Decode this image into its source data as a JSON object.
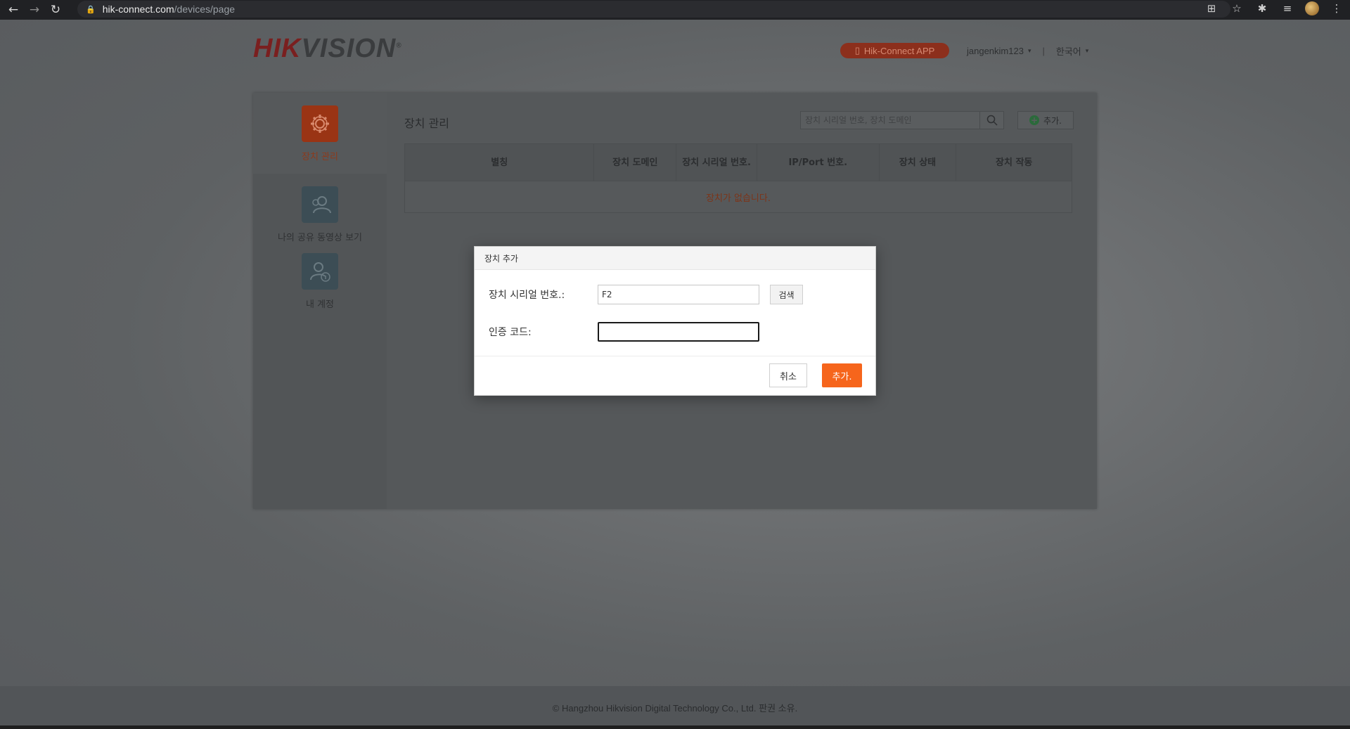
{
  "browser": {
    "url_domain": "hik-connect.com",
    "url_path": "/devices/page"
  },
  "header": {
    "logo_hik": "HIK",
    "logo_vision": "VISION",
    "app_button": "Hik-Connect APP",
    "username": "jangenkim123",
    "language": "한국어"
  },
  "sidebar": {
    "items": [
      {
        "label": "장치 관리",
        "icon": "gear-icon",
        "active": true
      },
      {
        "label": "나의 공유 동영상 보기",
        "icon": "shared-users-icon",
        "active": false
      },
      {
        "label": "내 계정",
        "icon": "account-info-icon",
        "active": false
      }
    ]
  },
  "main": {
    "title": "장치 관리",
    "search_placeholder": "장치 시리얼 번호, 장치 도메인",
    "add_button": "추가.",
    "table": {
      "columns": [
        "별칭",
        "장치 도메인",
        "장치 시리얼 번호.",
        "IP/Port 번호.",
        "장치 상태",
        "장치 작동"
      ],
      "empty_text": "장치가 없습니다."
    }
  },
  "dialog": {
    "title": "장치 추가",
    "serial_label": "장치 시리얼 번호.:",
    "serial_value": "F2",
    "search_button": "검색",
    "code_label": "인증 코드:",
    "code_value": "",
    "cancel_button": "취소",
    "add_button": "추가."
  },
  "footer": {
    "copyright": "© Hangzhou Hikvision Digital Technology Co., Ltd. 판권 소유."
  },
  "colors": {
    "accent": "#f6651c",
    "brand_red": "#c62828"
  }
}
